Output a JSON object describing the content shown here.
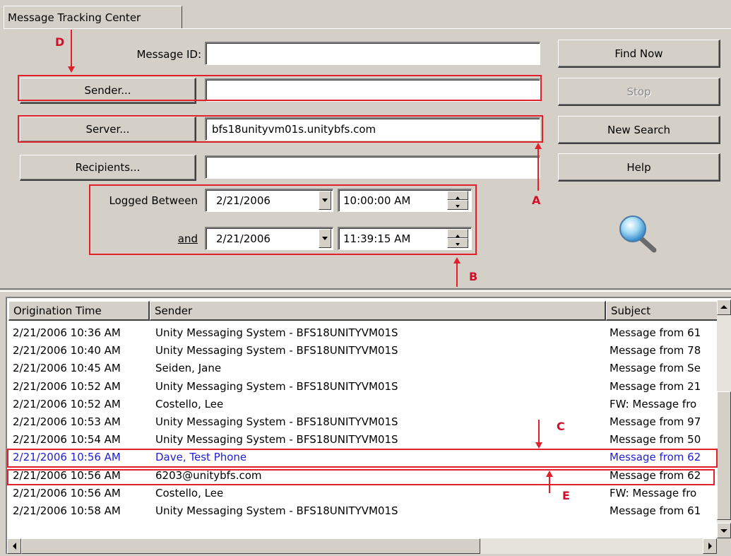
{
  "window": {
    "tab_title": "Message Tracking Center"
  },
  "form": {
    "message_id_label": "Message ID:",
    "message_id_value": "",
    "sender_button": "Sender...",
    "sender_value": "",
    "server_button": "Server...",
    "server_value": "bfs18unityvm01s.unitybfs.com",
    "recipients_button": "Recipients...",
    "recipients_value": "",
    "logged_between_label": "Logged Between",
    "and_label": "and",
    "start_date": "2/21/2006",
    "start_time": "10:00:00 AM",
    "end_date": "2/21/2006",
    "end_time": "11:39:15 AM"
  },
  "actions": {
    "find_now": "Find Now",
    "stop": "Stop",
    "new_search": "New Search",
    "help": "Help"
  },
  "annotations": {
    "A": "A",
    "B": "B",
    "C": "C",
    "D": "D",
    "E": "E"
  },
  "table": {
    "columns": [
      "Origination Time",
      "Sender",
      "Subject"
    ],
    "rows": [
      {
        "time": "2/21/2006  10:36 AM",
        "sender": "Unity Messaging System - BFS18UNITYVM01S",
        "subject": "Message from 61"
      },
      {
        "time": "2/21/2006  10:40 AM",
        "sender": "Unity Messaging System - BFS18UNITYVM01S",
        "subject": "Message from 78"
      },
      {
        "time": "2/21/2006  10:45 AM",
        "sender": "Seiden, Jane",
        "subject": "Message from Se"
      },
      {
        "time": "2/21/2006  10:52 AM",
        "sender": "Unity Messaging System - BFS18UNITYVM01S",
        "subject": "Message from 21"
      },
      {
        "time": "2/21/2006  10:52 AM",
        "sender": "Costello, Lee",
        "subject": "FW: Message fro"
      },
      {
        "time": "2/21/2006  10:53 AM",
        "sender": "Unity Messaging System - BFS18UNITYVM01S",
        "subject": "Message from 97"
      },
      {
        "time": "2/21/2006  10:54 AM",
        "sender": "Unity Messaging System - BFS18UNITYVM01S",
        "subject": "Message from 50"
      },
      {
        "time": "2/21/2006  10:56 AM",
        "sender": "Dave, Test Phone",
        "subject": "Message from 62"
      },
      {
        "time": "2/21/2006  10:56 AM",
        "sender": "6203@unitybfs.com",
        "subject": "Message from 62"
      },
      {
        "time": "2/21/2006  10:56 AM",
        "sender": "Costello, Lee",
        "subject": "FW: Message fro"
      },
      {
        "time": "2/21/2006  10:58 AM",
        "sender": "Unity Messaging System - BFS18UNITYVM01S",
        "subject": "Message from 61"
      }
    ],
    "selected_row_index": 7
  },
  "colors": {
    "annotation": "#e0202a",
    "selected_text": "#2020d8",
    "window_bg": "#d4d0c8"
  },
  "icons": {
    "search": "magnifier-icon"
  }
}
